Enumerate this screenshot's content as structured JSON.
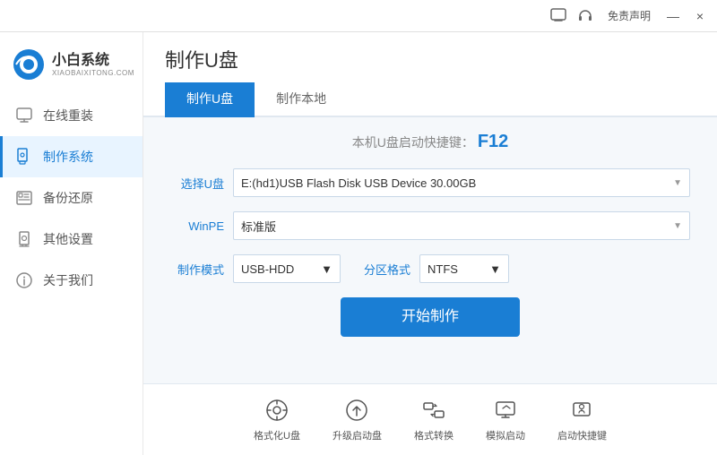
{
  "titlebar": {
    "free_label": "免责声明",
    "min_label": "—",
    "close_label": "×"
  },
  "logo": {
    "name": "小白系统",
    "sub": "XIAOBAIXITONG.COM"
  },
  "sidebar": {
    "items": [
      {
        "id": "online-reinstall",
        "label": "在线重装",
        "icon": "🖥"
      },
      {
        "id": "make-system",
        "label": "制作系统",
        "icon": "💾"
      },
      {
        "id": "backup-restore",
        "label": "备份还原",
        "icon": "🗄"
      },
      {
        "id": "other-settings",
        "label": "其他设置",
        "icon": "🔒"
      },
      {
        "id": "about-us",
        "label": "关于我们",
        "icon": "ℹ"
      }
    ]
  },
  "page": {
    "title": "制作U盘",
    "tabs": [
      {
        "id": "make-udisk",
        "label": "制作U盘",
        "active": true
      },
      {
        "id": "make-local",
        "label": "制作本地",
        "active": false
      }
    ]
  },
  "form": {
    "shortcut_prefix": "本机U盘启动快捷键：",
    "shortcut_key": "F12",
    "select_udisk_label": "选择U盘",
    "select_udisk_value": "E:(hd1)USB Flash Disk USB Device 30.00GB",
    "winpe_label": "WinPE",
    "winpe_value": "标准版",
    "make_mode_label": "制作模式",
    "make_mode_value": "USB-HDD",
    "partition_label": "分区格式",
    "partition_value": "NTFS",
    "start_btn_label": "开始制作"
  },
  "toolbar": {
    "items": [
      {
        "id": "format-udisk",
        "label": "格式化U盘",
        "icon": "⊙"
      },
      {
        "id": "upgrade-boot",
        "label": "升级启动盘",
        "icon": "⊕"
      },
      {
        "id": "format-convert",
        "label": "格式转换",
        "icon": "⇄"
      },
      {
        "id": "simulate-boot",
        "label": "模拟启动",
        "icon": "⊞"
      },
      {
        "id": "boot-shortcut",
        "label": "启动快捷键",
        "icon": "🔑"
      }
    ]
  }
}
